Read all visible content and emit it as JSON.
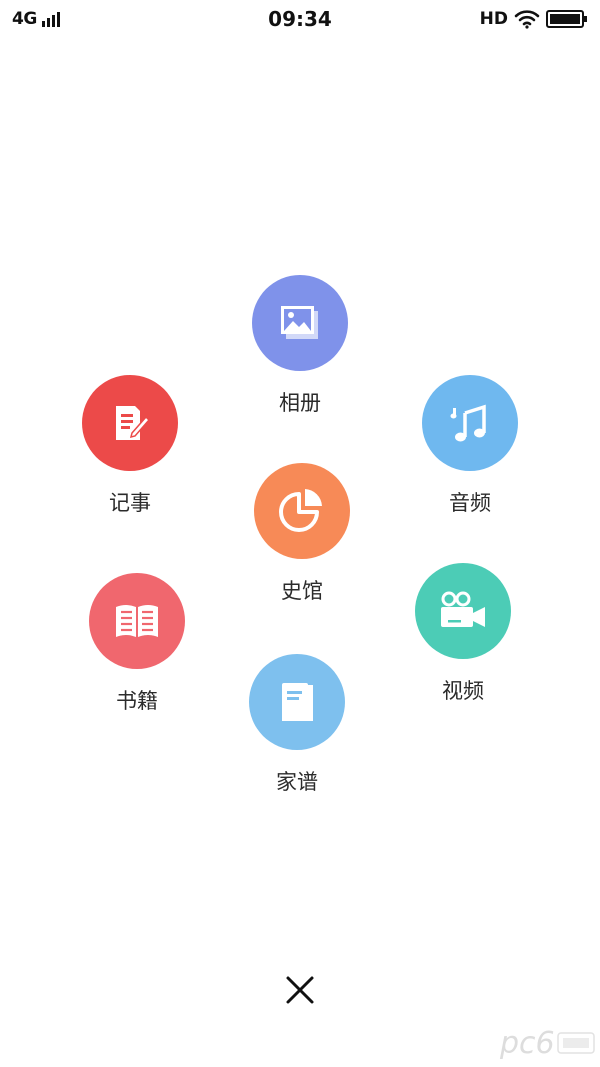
{
  "status_bar": {
    "network": "4G",
    "time": "09:34",
    "hd": "HD"
  },
  "menu": {
    "album": {
      "label": "相册",
      "icon": "image-gallery-icon",
      "color": "#7f92ea"
    },
    "notes": {
      "label": "记事",
      "icon": "note-edit-icon",
      "color": "#ec4a49"
    },
    "audio": {
      "label": "音频",
      "icon": "music-note-icon",
      "color": "#6fb8ef"
    },
    "hall": {
      "label": "史馆",
      "icon": "pie-chart-icon",
      "color": "#f78a57"
    },
    "books": {
      "label": "书籍",
      "icon": "open-book-icon",
      "color": "#f0676e"
    },
    "video": {
      "label": "视频",
      "icon": "video-camera-icon",
      "color": "#4cccb6"
    },
    "genealogy": {
      "label": "家谱",
      "icon": "closed-book-icon",
      "color": "#7ec0ee"
    }
  },
  "close": {
    "icon": "close-icon"
  },
  "watermark": {
    "text": "pc6"
  }
}
